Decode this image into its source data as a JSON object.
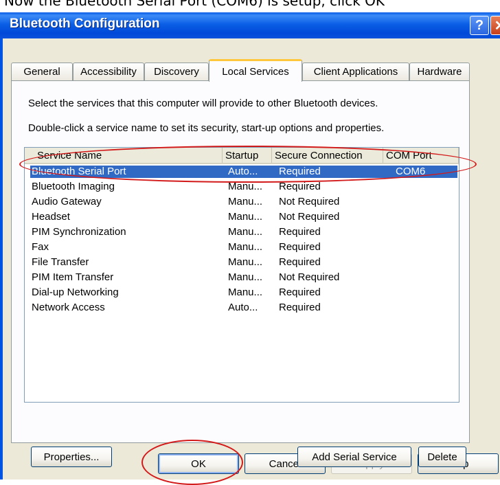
{
  "top_strip_text": "Now the Bluetooth Serial Port (COM6) is setup, click OK",
  "window": {
    "title": "Bluetooth Configuration",
    "help_glyph": "?",
    "close_glyph": "✕"
  },
  "tabs": [
    {
      "label": "General"
    },
    {
      "label": "Accessibility"
    },
    {
      "label": "Discovery"
    },
    {
      "label": "Local Services"
    },
    {
      "label": "Client Applications"
    },
    {
      "label": "Hardware"
    }
  ],
  "active_tab": "Local Services",
  "instructions": [
    "Select the services that this computer will provide to other Bluetooth devices.",
    "Double-click a service name to set its security, start-up options and properties."
  ],
  "list": {
    "columns": [
      "Service Name",
      "Startup",
      "Secure Connection",
      "COM Port"
    ],
    "rows": [
      {
        "name": "Bluetooth Serial Port",
        "startup": "Auto...",
        "secure": "Required",
        "com": "COM6"
      },
      {
        "name": "Bluetooth Imaging",
        "startup": "Manu...",
        "secure": "Required",
        "com": ""
      },
      {
        "name": "Audio Gateway",
        "startup": "Manu...",
        "secure": "Not Required",
        "com": ""
      },
      {
        "name": "Headset",
        "startup": "Manu...",
        "secure": "Not Required",
        "com": ""
      },
      {
        "name": "PIM Synchronization",
        "startup": "Manu...",
        "secure": "Required",
        "com": ""
      },
      {
        "name": "Fax",
        "startup": "Manu...",
        "secure": "Required",
        "com": ""
      },
      {
        "name": "File Transfer",
        "startup": "Manu...",
        "secure": "Required",
        "com": ""
      },
      {
        "name": "PIM Item Transfer",
        "startup": "Manu...",
        "secure": "Not Required",
        "com": ""
      },
      {
        "name": "Dial-up Networking",
        "startup": "Manu...",
        "secure": "Required",
        "com": ""
      },
      {
        "name": "Network Access",
        "startup": "Auto...",
        "secure": "Required",
        "com": ""
      }
    ],
    "selected_index": 0
  },
  "panel_buttons": {
    "properties": "Properties...",
    "add_serial": "Add Serial Service",
    "delete": "Delete"
  },
  "dialog_buttons": {
    "ok": "OK",
    "cancel": "Cancel",
    "apply": "Apply",
    "help": "Help"
  },
  "colors": {
    "titlebar": "#0054e3",
    "selection": "#316ac5",
    "annotation": "#d31a1a",
    "dialog_face": "#ece9d8"
  }
}
